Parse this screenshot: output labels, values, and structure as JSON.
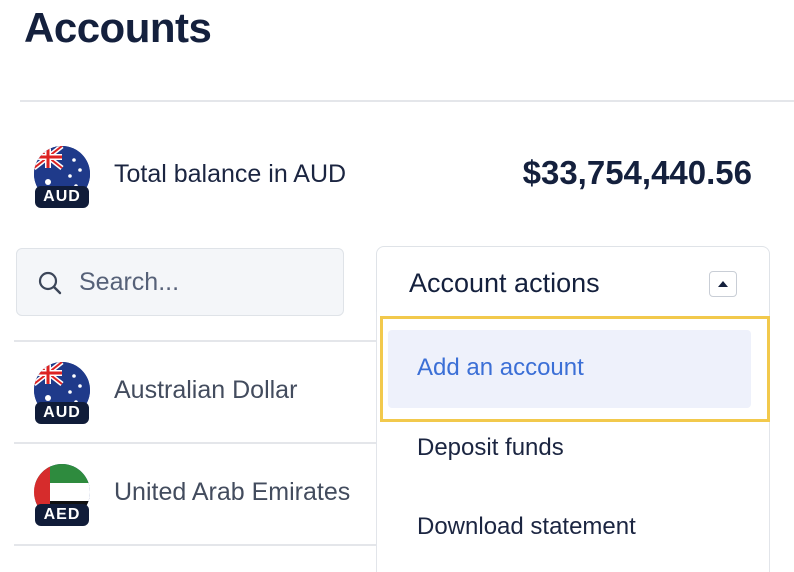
{
  "page": {
    "title": "Accounts"
  },
  "summary": {
    "currency_code": "AUD",
    "label": "Total balance in AUD",
    "amount": "$33,754,440.56"
  },
  "search": {
    "placeholder": "Search..."
  },
  "account_actions": {
    "label": "Account actions",
    "menu": [
      {
        "label": "Add an account",
        "state": "highlighted"
      },
      {
        "label": "Deposit funds"
      },
      {
        "label": "Download statement"
      }
    ]
  },
  "accounts": [
    {
      "code": "AUD",
      "name": "Australian Dollar",
      "flag_icon": "australia-flag-icon"
    },
    {
      "code": "AED",
      "name": "United Arab Emirates",
      "flag_icon": "uae-flag-icon"
    }
  ],
  "colors": {
    "accent_link": "#3b6fd6",
    "highlight_ring": "#f2c94c",
    "badge_bg": "#101c39",
    "heading": "#14203d"
  }
}
